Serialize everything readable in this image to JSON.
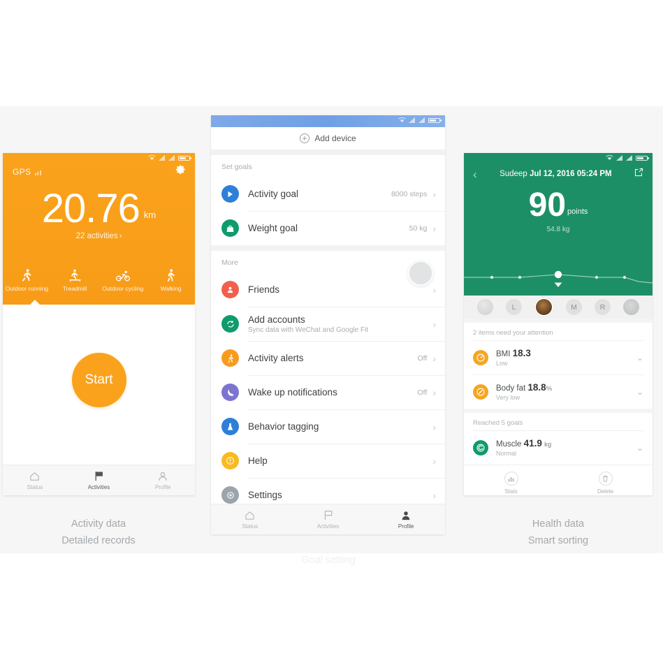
{
  "left_phone": {
    "statusbar": {
      "wifi": "wifi-icon",
      "signal1": "signal-icon",
      "signal2": "signal-icon",
      "battery": "battery-icon"
    },
    "gps_label": "GPS",
    "gear": "gear-icon",
    "distance_value": "20.76",
    "distance_unit": "km",
    "activities_text": "22 activities",
    "chevron": "›",
    "modes": [
      {
        "label": "Outdoor running",
        "icon": "running-icon"
      },
      {
        "label": "Treadmill",
        "icon": "treadmill-icon"
      },
      {
        "label": "Outdoor cycling",
        "icon": "cycling-icon"
      },
      {
        "label": "Walking",
        "icon": "walking-icon"
      }
    ],
    "start_label": "Start",
    "tabs": [
      {
        "label": "Status",
        "icon": "home-icon",
        "active": false
      },
      {
        "label": "Activities",
        "icon": "flag-icon",
        "active": true
      },
      {
        "label": "Profile",
        "icon": "person-icon",
        "active": false
      }
    ],
    "caption_line1": "Activity data",
    "caption_line2": "Detailed records"
  },
  "center_phone": {
    "add_device_label": "Add device",
    "sections": [
      {
        "heading": "Set goals",
        "rows": [
          {
            "title": "Activity goal",
            "sub": "",
            "value": "8000 steps",
            "icon": "play-circle-icon",
            "color": "#2d7fd8"
          },
          {
            "title": "Weight goal",
            "sub": "",
            "value": "50 kg",
            "icon": "weight-bag-icon",
            "color": "#0f9b6c"
          }
        ]
      },
      {
        "heading": "More",
        "rows": [
          {
            "title": "Friends",
            "sub": "",
            "value": "",
            "icon": "friends-icon",
            "color": "#f0604d"
          },
          {
            "title": "Add accounts",
            "sub": "Sync data with WeChat and Google Fit",
            "value": "",
            "icon": "sync-accounts-icon",
            "color": "#0f9b6c"
          },
          {
            "title": "Activity alerts",
            "sub": "",
            "value": "Off",
            "icon": "activity-alert-icon",
            "color": "#f79b1f"
          },
          {
            "title": "Wake up notifications",
            "sub": "",
            "value": "Off",
            "icon": "moon-icon",
            "color": "#7b74d1"
          },
          {
            "title": "Behavior tagging",
            "sub": "",
            "value": "",
            "icon": "flask-icon",
            "color": "#2d7fd8"
          },
          {
            "title": "Help",
            "sub": "",
            "value": "",
            "icon": "help-icon",
            "color": "#f9ba1f"
          },
          {
            "title": "Settings",
            "sub": "",
            "value": "",
            "icon": "settings-icon",
            "color": "#9ba5ab"
          }
        ]
      }
    ],
    "tabs": [
      {
        "label": "Status",
        "icon": "home-icon",
        "active": false
      },
      {
        "label": "Activities",
        "icon": "flag-icon",
        "active": false
      },
      {
        "label": "Profile",
        "icon": "person-icon",
        "active": true
      }
    ],
    "caption_line1": "Goal setting"
  },
  "right_phone": {
    "user_name": "Sudeep",
    "timestamp": "Jul 12, 2016 05:24 PM",
    "score_value": "90",
    "score_unit": "points",
    "weight_text": "54.8  kg",
    "avatars": [
      {
        "label": "",
        "type": "photo1"
      },
      {
        "label": "L",
        "type": "letter"
      },
      {
        "label": "",
        "type": "selected"
      },
      {
        "label": "M",
        "type": "letter"
      },
      {
        "label": "R",
        "type": "letter"
      },
      {
        "label": "",
        "type": "photo2"
      }
    ],
    "attention_heading": "2 items need your attention",
    "attention_rows": [
      {
        "name": "BMI",
        "value": "18.3",
        "unit": "",
        "status": "Low",
        "color": "#f5a623"
      },
      {
        "name": "Body fat",
        "value": "18.8",
        "unit": "%",
        "status": "Very low",
        "color": "#f5a623"
      }
    ],
    "goals_heading": "Reached 5 goals",
    "goal_rows": [
      {
        "name": "Muscle",
        "value": "41.9",
        "unit": "kg",
        "status": "Normal",
        "color": "#0f9b6c"
      }
    ],
    "actions": [
      {
        "label": "Stats",
        "icon": "bar-chart-icon"
      },
      {
        "label": "Delete",
        "icon": "trash-icon"
      }
    ],
    "caption_line1": "Health data",
    "caption_line2": "Smart sorting"
  },
  "theme": {
    "orange": "#faa21c",
    "green": "#1d8f66",
    "blue": "#6f9fe4",
    "page_bg": "#ffffff",
    "band_bg": "#f6f6f6"
  }
}
